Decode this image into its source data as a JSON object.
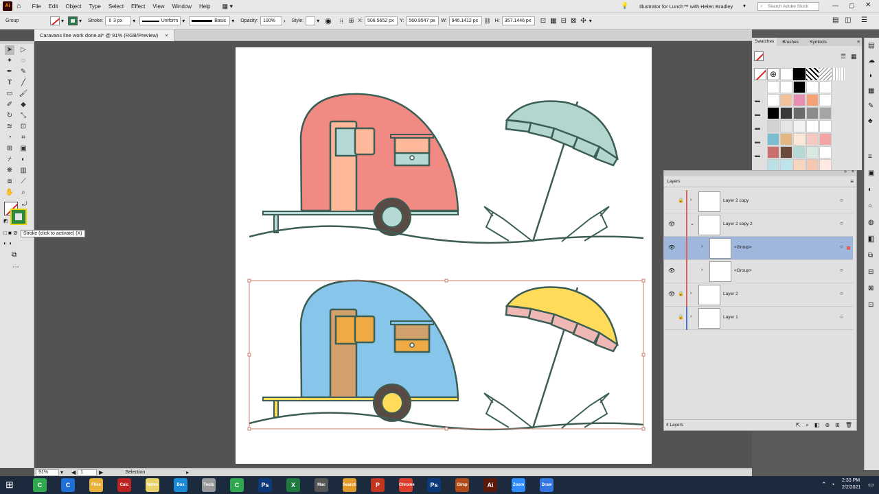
{
  "menubar": {
    "app_logo": "Ai",
    "items": [
      "File",
      "Edit",
      "Object",
      "Type",
      "Select",
      "Effect",
      "View",
      "Window",
      "Help"
    ],
    "title": "Illustrator for Lunch™ with Helen Bradley",
    "search_placeholder": "Search Adobe Stock"
  },
  "control_bar": {
    "selection_type": "Group",
    "stroke_label": "Stroke:",
    "stroke_weight": "3 px",
    "profile": "Uniform",
    "brush": "Basic",
    "opacity_label": "Opacity:",
    "opacity": "100%",
    "style_label": "Style:",
    "x_label": "X:",
    "x": "506.5652 px",
    "y_label": "Y:",
    "y": "560.9547 px",
    "w_label": "W:",
    "w": "946.1412 px",
    "h_label": "H:",
    "h": "357.1446 px"
  },
  "document": {
    "tab_title": "Caravans line work done.ai* @ 91% (RGB/Preview)"
  },
  "tooltip": "Stroke (click to activate) (X)",
  "status_bar": {
    "zoom": "91%",
    "artboard": "1",
    "tool": "Selection"
  },
  "swatches_panel": {
    "tabs": [
      "Swatches",
      "Brushes",
      "Symbols"
    ],
    "rows": [
      [
        "#ffffff",
        "#ffffff",
        "#000000",
        "#ffffff",
        "#ffffff"
      ],
      [
        "#ffffff",
        "#f3c29a",
        "#e58fb3",
        "#f7a276",
        "#ffffff"
      ],
      [
        "#000000",
        "#3a3a3a",
        "#6b6b6b",
        "#8c8c8c",
        "#a5a5a5"
      ],
      [
        "#d2d2d2",
        "#e6e6e6",
        "#f2f2f2",
        "#ffffff",
        "#ffffff"
      ],
      [
        "#7bbcd1",
        "#e4b684",
        "#fbe7d6",
        "#f6c9c2",
        "#f3a5a5"
      ],
      [
        "#c9706f",
        "#6b4a3c",
        "#b5d9d4",
        "#d8e9e2",
        "#ffffff"
      ],
      [
        "#b8e0e5",
        "#bde4ec",
        "#f7d6c0",
        "#f5c7b0",
        "#ffe9e1"
      ]
    ]
  },
  "layers_panel": {
    "title": "Layers",
    "footer": "4 Layers",
    "rows": [
      {
        "name": "Layer 2 copy",
        "color": "#e0605a"
      },
      {
        "name": "Layer 2 copy 2",
        "color": "#e0605a"
      },
      {
        "name": "<Group>",
        "color": "#e0605a"
      },
      {
        "name": "<Group>",
        "color": "#e0605a"
      },
      {
        "name": "Layer 2",
        "color": "#e0605a"
      },
      {
        "name": "Layer 1",
        "color": "#4a6fd8"
      }
    ]
  },
  "taskbar": {
    "time": "2:33 PM",
    "date": "2/2/2021",
    "apps": [
      "C",
      "C",
      "Files",
      "Calc",
      "Notes",
      "Box",
      "Tools",
      "C",
      "Ps",
      "X",
      "Mac",
      "Search",
      "P",
      "Chrome",
      "Ps",
      "Gimp",
      "Ai",
      "Zoom",
      "Draw"
    ]
  },
  "colors": {
    "selection_blue": "#9fb7dc",
    "caravan_pink": "#f08a82",
    "caravan_blue": "#87c5ea",
    "umbrella_teal": "#b3d7cf",
    "umbrella_yellow": "#ffdb5a",
    "outline": "#3c5e55"
  }
}
